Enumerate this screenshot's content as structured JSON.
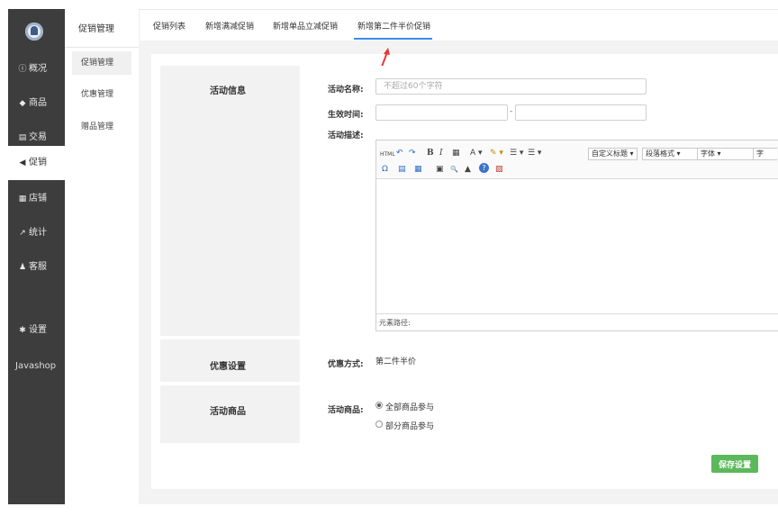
{
  "sidebar": {
    "items": [
      {
        "icon": "ⓘ",
        "label": "概况"
      },
      {
        "icon": "◆",
        "label": "商品"
      },
      {
        "icon": "▤",
        "label": "交易"
      },
      {
        "icon": "◀",
        "label": "促销"
      },
      {
        "icon": "▦",
        "label": "店铺"
      },
      {
        "icon": "↗",
        "label": "统计"
      },
      {
        "icon": "♟",
        "label": "客服"
      },
      {
        "icon": "✱",
        "label": "设置"
      }
    ],
    "brand": "Javashop"
  },
  "submenu": {
    "title": "促销管理",
    "items": [
      "促销管理",
      "优惠管理",
      "赠品管理"
    ]
  },
  "tabs": [
    "促销列表",
    "新增满减促销",
    "新增单品立减促销",
    "新增第二件半价促销"
  ],
  "activity_info": {
    "section_title": "活动信息",
    "name_label": "活动名称:",
    "name_placeholder": "不超过60个字符",
    "time_label": "生效时间:",
    "time_sep": "-",
    "desc_label": "活动描述:"
  },
  "editor": {
    "row1": [
      "HTML",
      "↶",
      "↷",
      "B",
      "I",
      "▦",
      "A ▾",
      "✎ ▾",
      "☰ ▾",
      "☰ ▾"
    ],
    "heading_select": "自定义标题",
    "para_select": "段落格式",
    "font_select": "字体",
    "size_select": "字",
    "row2": [
      "Ω",
      "▤",
      "▦",
      "▣",
      "🔍",
      "▲",
      "?",
      "▨"
    ],
    "path_label": "元素路径:"
  },
  "discount": {
    "section_title": "优惠设置",
    "label": "优惠方式:",
    "value": "第二件半价"
  },
  "goods": {
    "section_title": "活动商品",
    "label": "活动商品:",
    "options": [
      "全部商品参与",
      "部分商品参与"
    ]
  },
  "save_label": "保存设置",
  "colors": {
    "accent_tab": "#3a8ee6",
    "save": "#5cb85c",
    "sidebar": "#3d3d3d",
    "arrow": "#e53935"
  }
}
